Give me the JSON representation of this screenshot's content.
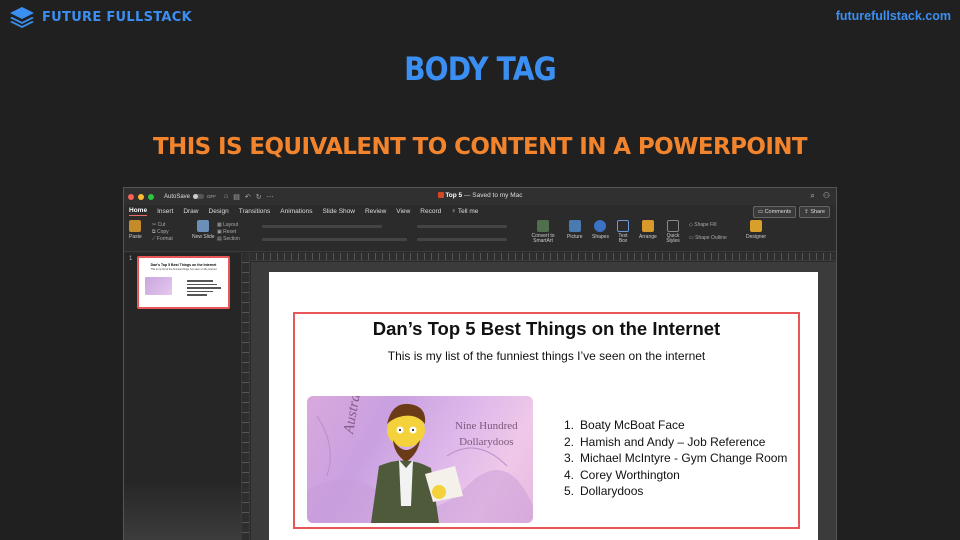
{
  "header": {
    "brand": "FUTURE FULLSTACK",
    "url": "futurefullstack.com",
    "title": "BODY TAG",
    "subtitle": "THIS IS EQUIVALENT TO CONTENT IN A POWERPOINT"
  },
  "app": {
    "autosave_label": "AutoSave",
    "autosave_state": "OFF",
    "doc_name": "Top 5",
    "doc_status": " — Saved to my Mac",
    "menu": [
      "Home",
      "Insert",
      "Draw",
      "Design",
      "Transitions",
      "Animations",
      "Slide Show",
      "Review",
      "View",
      "Record",
      "Tell me"
    ],
    "comments_label": "Comments",
    "share_label": "Share",
    "ribbon": {
      "paste": "Paste",
      "cut": "Cut",
      "copy": "Copy",
      "format": "Format",
      "new_slide": "New Slide",
      "layout": "Layout",
      "reset": "Reset",
      "section": "Section",
      "convert": "Convert to SmartArt",
      "picture": "Picture",
      "shapes": "Shapes",
      "text_box": "Text Box",
      "arrange": "Arrange",
      "quick_styles": "Quick Styles",
      "shape_fill": "Shape Fill",
      "shape_outline": "Shape Outline",
      "designer": "Designer"
    },
    "slide_number": "1",
    "accent_color": "#e8565a"
  },
  "slide": {
    "title": "Dan’s Top 5 Best Things on the Internet",
    "subtitle": "This is my list of the funniest things I’ve seen on the internet",
    "image_text_1": "Nine Hundred",
    "image_text_2": "Dollarydoos",
    "image_text_3": "Australia",
    "list": [
      {
        "n": "1.",
        "text": "Boaty McBoat Face"
      },
      {
        "n": "2.",
        "text": "Hamish and Andy – Job Reference"
      },
      {
        "n": "3.",
        "text": "Michael McIntyre - Gym Change Room"
      },
      {
        "n": "4.",
        "text": "Corey Worthington"
      },
      {
        "n": "5.",
        "text": "Dollarydoos"
      }
    ]
  }
}
